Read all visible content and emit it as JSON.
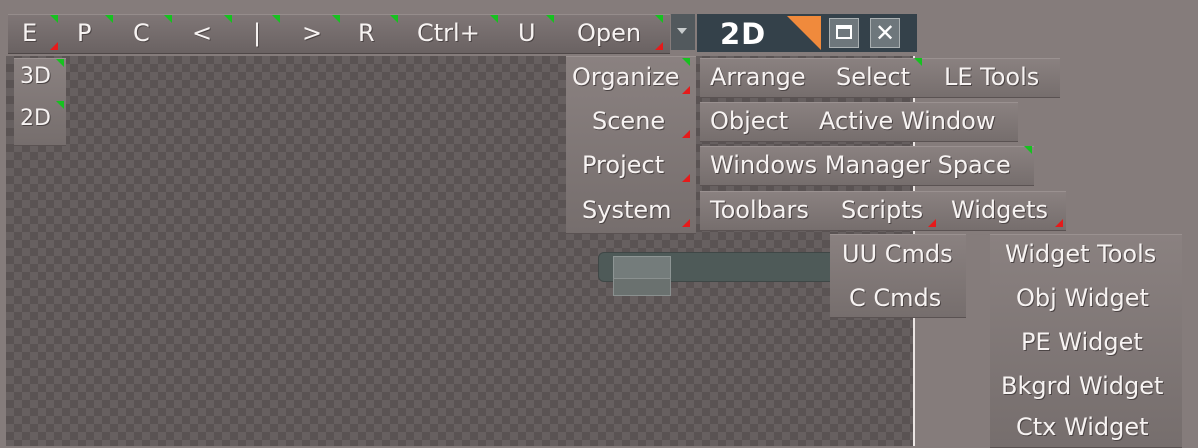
{
  "toolbar": {
    "items": [
      "E",
      "P",
      "C",
      "<",
      "|",
      ">",
      "R",
      "Ctrl+",
      "U",
      "Open"
    ]
  },
  "window": {
    "title": "2D",
    "close_glyph": "✕",
    "accent_color": "#f08a3c"
  },
  "side_buttons": [
    "3D",
    "2D"
  ],
  "menu": {
    "categories": [
      "Organize",
      "Scene",
      "Project",
      "System"
    ],
    "organize_items": [
      "Arrange",
      "Select",
      "LE Tools"
    ],
    "scene_items": [
      "Object",
      "Active Window"
    ],
    "project_items": [
      "Windows Manager Space"
    ],
    "system_items": [
      "Toolbars",
      "Scripts",
      "Widgets"
    ]
  },
  "scripts_menu": [
    "UU Cmds",
    "C Cmds"
  ],
  "widgets_menu": [
    "Widget Tools",
    "Obj Widget",
    "PE Widget",
    "Bkgrd Widget",
    "Ctx Widget"
  ],
  "icons": {
    "dropdown": "chevron-down-icon",
    "maximize": "maximize-icon",
    "close": "close-icon"
  }
}
